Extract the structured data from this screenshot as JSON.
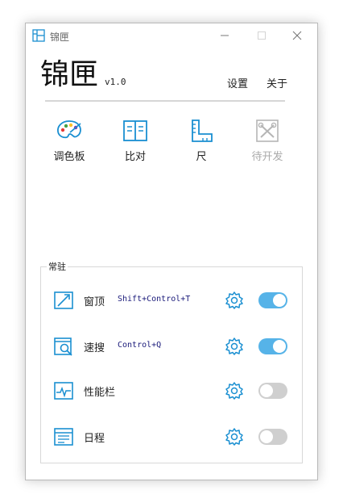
{
  "window": {
    "title": "锦匣"
  },
  "header": {
    "brand": "锦匣",
    "version": "v1.0",
    "settings_label": "设置",
    "about_label": "关于"
  },
  "tools": [
    {
      "label": "调色板",
      "icon": "palette-icon",
      "enabled": true
    },
    {
      "label": "比对",
      "icon": "compare-icon",
      "enabled": true
    },
    {
      "label": "尺",
      "icon": "ruler-icon",
      "enabled": true
    },
    {
      "label": "待开发",
      "icon": "tools-icon",
      "enabled": false
    }
  ],
  "resident": {
    "legend": "常驻",
    "items": [
      {
        "label": "窗顶",
        "hotkey": "Shift+Control+T",
        "icon": "pin-window-icon",
        "enabled": true
      },
      {
        "label": "速搜",
        "hotkey": "Control+Q",
        "icon": "search-window-icon",
        "enabled": true
      },
      {
        "label": "性能栏",
        "hotkey": "",
        "icon": "performance-icon",
        "enabled": false
      },
      {
        "label": "日程",
        "hotkey": "",
        "icon": "schedule-icon",
        "enabled": false
      }
    ]
  },
  "colors": {
    "accent": "#1a8fd1",
    "toggle_on": "#56b3e8",
    "toggle_off": "#cfcfcf",
    "disabled": "#aaaaaa"
  }
}
